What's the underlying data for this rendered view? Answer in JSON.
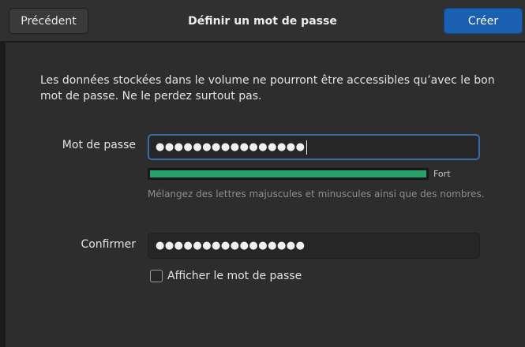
{
  "header": {
    "back_label": "Précédent",
    "title": "Définir un mot de passe",
    "create_label": "Créer"
  },
  "description": "Les données stockées dans le volume ne pourront être accessibles qu’avec le bon mot de passe. Ne le perdez surtout pas.",
  "password": {
    "label": "Mot de passe",
    "value_masked": "●●●●●●●●●●●●●●●●"
  },
  "strength": {
    "level": 1.0,
    "label": "Fort",
    "color": "#26a269",
    "hint": "Mélangez des lettres majuscules et minuscules ainsi que des nombres."
  },
  "confirm": {
    "label": "Confirmer",
    "value_masked": "●●●●●●●●●●●●●●●●"
  },
  "show_password": {
    "label": "Afficher le mot de passe",
    "checked": false
  },
  "colors": {
    "accent": "#1a5fb0",
    "focus_border": "#3b6aa5"
  }
}
